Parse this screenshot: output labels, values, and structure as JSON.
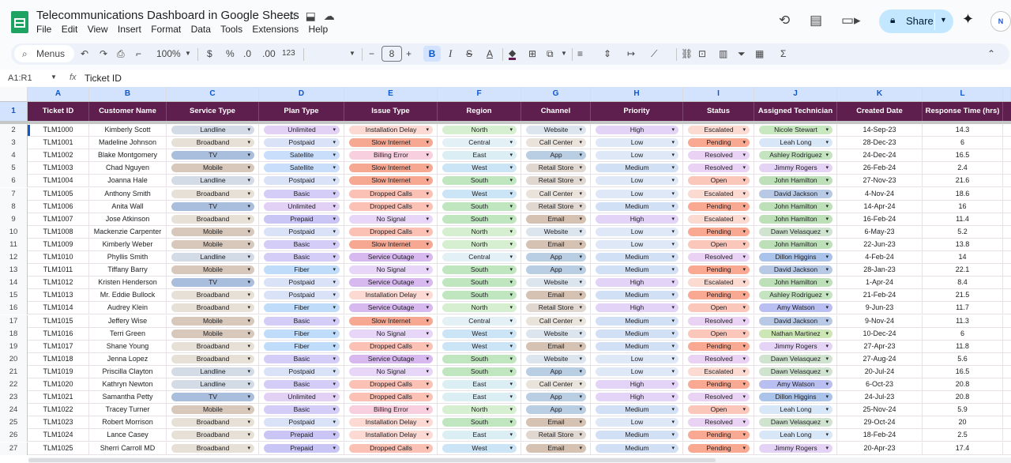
{
  "doc": {
    "title": "Telecommunications Dashboard in Google Sheets",
    "menus": [
      "File",
      "Edit",
      "View",
      "Insert",
      "Format",
      "Data",
      "Tools",
      "Extensions",
      "Help"
    ],
    "share_label": "Share",
    "avatar_text": "N"
  },
  "toolbar": {
    "search_label": "Menus",
    "zoom": "100%",
    "currency": "$",
    "percent": "%",
    "dec_less": ".0",
    "dec_more": ".00",
    "number_format": "123",
    "font_size": "8",
    "bold": "B",
    "italic": "I",
    "strike": "S",
    "text_color": "A",
    "minus": "−",
    "plus": "+",
    "sigma": "Σ"
  },
  "formula": {
    "namebox": "A1:R1",
    "fx": "fx",
    "content": "Ticket ID"
  },
  "grid": {
    "column_letters": [
      "A",
      "B",
      "C",
      "D",
      "E",
      "F",
      "G",
      "H",
      "I",
      "J",
      "K",
      "L"
    ],
    "headers": [
      "Ticket ID",
      "Customer Name",
      "Service Type",
      "Plan Type",
      "Issue Type",
      "Region",
      "Channel",
      "Priority",
      "Status",
      "Assigned Technician",
      "Created Date",
      "Response Time (hrs)"
    ],
    "rows": [
      [
        "2",
        "TLM1000",
        "Kimberly Scott",
        "Landline",
        "Unlimited",
        "Installation Delay",
        "North",
        "Website",
        "High",
        "Escalated",
        "Nicole Stewart",
        "14-Sep-23",
        "14.3"
      ],
      [
        "3",
        "TLM1001",
        "Madeline Johnson",
        "Broadband",
        "Postpaid",
        "Slow Internet",
        "Central",
        "Call Center",
        "Low",
        "Pending",
        "Leah Long",
        "28-Dec-23",
        "6"
      ],
      [
        "4",
        "TLM1002",
        "Blake Montgomery",
        "TV",
        "Satellite",
        "Billing Error",
        "East",
        "App",
        "Low",
        "Resolved",
        "Ashley Rodriguez",
        "24-Dec-24",
        "16.5"
      ],
      [
        "5",
        "TLM1003",
        "Chad Nguyen",
        "Mobile",
        "Satellite",
        "Slow Internet",
        "West",
        "Retail Store",
        "Medium",
        "Resolved",
        "Jimmy Rogers",
        "26-Feb-24",
        "2.4"
      ],
      [
        "6",
        "TLM1004",
        "Joanna Hale",
        "Landline",
        "Postpaid",
        "Slow Internet",
        "South",
        "Retail Store",
        "Low",
        "Open",
        "John Hamilton",
        "27-Nov-23",
        "21.6"
      ],
      [
        "7",
        "TLM1005",
        "Anthony Smith",
        "Broadband",
        "Basic",
        "Dropped Calls",
        "West",
        "Call Center",
        "Low",
        "Escalated",
        "David Jackson",
        "4-Nov-24",
        "18.6"
      ],
      [
        "8",
        "TLM1006",
        "Anita Wall",
        "TV",
        "Unlimited",
        "Dropped Calls",
        "South",
        "Retail Store",
        "Medium",
        "Pending",
        "John Hamilton",
        "14-Apr-24",
        "16"
      ],
      [
        "9",
        "TLM1007",
        "Jose Atkinson",
        "Broadband",
        "Prepaid",
        "No Signal",
        "South",
        "Email",
        "High",
        "Escalated",
        "John Hamilton",
        "16-Feb-24",
        "11.4"
      ],
      [
        "10",
        "TLM1008",
        "Mackenzie Carpenter",
        "Mobile",
        "Postpaid",
        "Dropped Calls",
        "North",
        "Website",
        "Low",
        "Pending",
        "Dawn Velasquez",
        "6-May-23",
        "5.2"
      ],
      [
        "11",
        "TLM1009",
        "Kimberly Weber",
        "Mobile",
        "Basic",
        "Slow Internet",
        "North",
        "Email",
        "Low",
        "Open",
        "John Hamilton",
        "22-Jun-23",
        "13.8"
      ],
      [
        "12",
        "TLM1010",
        "Phyllis Smith",
        "Landline",
        "Basic",
        "Service Outage",
        "Central",
        "App",
        "Medium",
        "Resolved",
        "Dillon Higgins",
        "4-Feb-24",
        "14"
      ],
      [
        "13",
        "TLM1011",
        "Tiffany Barry",
        "Mobile",
        "Fiber",
        "No Signal",
        "South",
        "App",
        "Medium",
        "Pending",
        "David Jackson",
        "28-Jan-23",
        "22.1"
      ],
      [
        "14",
        "TLM1012",
        "Kristen Henderson",
        "TV",
        "Postpaid",
        "Service Outage",
        "South",
        "Website",
        "High",
        "Escalated",
        "John Hamilton",
        "1-Apr-24",
        "8.4"
      ],
      [
        "15",
        "TLM1013",
        "Mr. Eddie Bullock",
        "Broadband",
        "Postpaid",
        "Installation Delay",
        "South",
        "Email",
        "Medium",
        "Pending",
        "Ashley Rodriguez",
        "21-Feb-24",
        "21.5"
      ],
      [
        "16",
        "TLM1014",
        "Audrey Klein",
        "Broadband",
        "Fiber",
        "Service Outage",
        "North",
        "Retail Store",
        "High",
        "Open",
        "Amy Watson",
        "9-Jun-23",
        "11.7"
      ],
      [
        "17",
        "TLM1015",
        "Jeffery Wise",
        "Mobile",
        "Basic",
        "Slow Internet",
        "Central",
        "Call Center",
        "Medium",
        "Resolved",
        "David Jackson",
        "9-Nov-24",
        "11.3"
      ],
      [
        "18",
        "TLM1016",
        "Terri Green",
        "Mobile",
        "Fiber",
        "No Signal",
        "West",
        "Website",
        "Medium",
        "Open",
        "Nathan Martinez",
        "10-Dec-24",
        "6"
      ],
      [
        "19",
        "TLM1017",
        "Shane Young",
        "Broadband",
        "Fiber",
        "Dropped Calls",
        "West",
        "Email",
        "Medium",
        "Pending",
        "Jimmy Rogers",
        "27-Apr-23",
        "11.8"
      ],
      [
        "20",
        "TLM1018",
        "Jenna Lopez",
        "Broadband",
        "Basic",
        "Service Outage",
        "South",
        "Website",
        "Low",
        "Resolved",
        "Dawn Velasquez",
        "27-Aug-24",
        "5.6"
      ],
      [
        "21",
        "TLM1019",
        "Priscilla Clayton",
        "Landline",
        "Postpaid",
        "No Signal",
        "South",
        "App",
        "Low",
        "Escalated",
        "Dawn Velasquez",
        "20-Jul-24",
        "16.5"
      ],
      [
        "22",
        "TLM1020",
        "Kathryn Newton",
        "Landline",
        "Basic",
        "Dropped Calls",
        "East",
        "Call Center",
        "High",
        "Pending",
        "Amy Watson",
        "6-Oct-23",
        "20.8"
      ],
      [
        "23",
        "TLM1021",
        "Samantha Petty",
        "TV",
        "Unlimited",
        "Dropped Calls",
        "East",
        "App",
        "High",
        "Resolved",
        "Dillon Higgins",
        "24-Jul-23",
        "20.8"
      ],
      [
        "24",
        "TLM1022",
        "Tracey Turner",
        "Mobile",
        "Basic",
        "Billing Error",
        "North",
        "App",
        "Medium",
        "Open",
        "Leah Long",
        "25-Nov-24",
        "5.9"
      ],
      [
        "25",
        "TLM1023",
        "Robert Morrison",
        "Broadband",
        "Postpaid",
        "Installation Delay",
        "South",
        "Email",
        "Low",
        "Resolved",
        "Dawn Velasquez",
        "29-Oct-24",
        "20"
      ],
      [
        "26",
        "TLM1024",
        "Lance Casey",
        "Broadband",
        "Prepaid",
        "Installation Delay",
        "East",
        "Retail Store",
        "Medium",
        "Pending",
        "Leah Long",
        "18-Feb-24",
        "2.5"
      ],
      [
        "27",
        "TLM1025",
        "Sherri Carroll MD",
        "Broadband",
        "Prepaid",
        "Dropped Calls",
        "West",
        "Email",
        "Medium",
        "Pending",
        "Jimmy Rogers",
        "20-Apr-23",
        "17.4"
      ]
    ]
  },
  "chip_colors": {
    "service": {
      "Landline": "#d3dbe6",
      "Broadband": "#e6e0d6",
      "TV": "#a9bedc",
      "Mobile": "#d8c8bb"
    },
    "plan": {
      "Unlimited": "#e2d0f5",
      "Postpaid": "#d9e2f7",
      "Satellite": "#c9defa",
      "Basic": "#d4cdf7",
      "Prepaid": "#c9c6f5",
      "Fiber": "#bfdcfa"
    },
    "issue": {
      "Installation Delay": "#fcd9d2",
      "Slow Internet": "#f7a893",
      "Billing Error": "#f8cfdf",
      "Dropped Calls": "#fbc1b5",
      "No Signal": "#e7d6f7",
      "Service Outage": "#d7b8ef"
    },
    "region": {
      "North": "#d6efd0",
      "Central": "#e3f0f5",
      "East": "#dbeef3",
      "West": "#cbe4f6",
      "South": "#bfe6bf"
    },
    "channel": {
      "Website": "#dce4ee",
      "Call Center": "#e9e3dc",
      "App": "#b9cde3",
      "Retail Store": "#e0d8d0",
      "Email": "#d6c2b2"
    },
    "priority": {
      "High": "#e3d3f7",
      "Low": "#dfe8f7",
      "Medium": "#d2e0f5"
    },
    "status": {
      "Escalated": "#fbdad2",
      "Pending": "#f9a891",
      "Resolved": "#ead2f4",
      "Open": "#fbc7bb"
    },
    "tech": {
      "Nicole Stewart": "#c8e8c0",
      "Leah Long": "#d8e7f7",
      "Ashley Rodriguez": "#c4e4c0",
      "Jimmy Rogers": "#e5d3f5",
      "John Hamilton": "#bde0b8",
      "David Jackson": "#b8c9e6",
      "Dawn Velasquez": "#cfe3cf",
      "Dillon Higgins": "#a9c3ea",
      "Amy Watson": "#b9bff0",
      "Nathan Martinez": "#cce6b4"
    }
  },
  "colors": {
    "header_bg": "#5e1f4e",
    "accent": "#0b57d0"
  }
}
